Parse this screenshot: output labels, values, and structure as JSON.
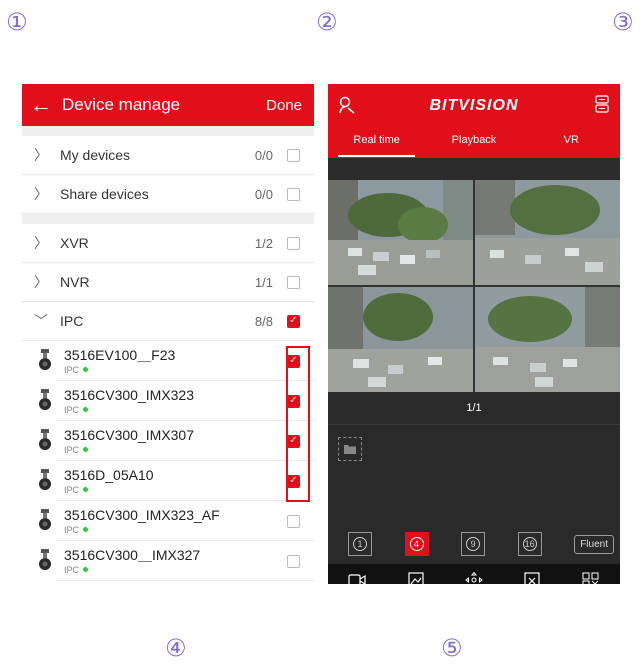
{
  "steps": [
    "①",
    "②",
    "③",
    "④",
    "⑤"
  ],
  "left": {
    "header": {
      "back_icon": "←",
      "title": "Device manage",
      "done": "Done"
    },
    "groups_top": [
      {
        "label": "My devices",
        "count": "0/0",
        "checked": false
      },
      {
        "label": "Share devices",
        "count": "0/0",
        "checked": false
      }
    ],
    "groups_mid": [
      {
        "label": "XVR",
        "count": "1/2",
        "checked": false
      },
      {
        "label": "NVR",
        "count": "1/1",
        "checked": false
      }
    ],
    "ipc_group": {
      "label": "IPC",
      "count": "8/8",
      "checked": true,
      "expanded": true
    },
    "devices": [
      {
        "name": "3516EV100＿F23",
        "type": "IPC",
        "online": true,
        "checked": true
      },
      {
        "name": "3516CV300_IMX323",
        "type": "IPC",
        "online": true,
        "checked": true
      },
      {
        "name": "3516CV300_IMX307",
        "type": "IPC",
        "online": true,
        "checked": true
      },
      {
        "name": "3516D_05A10",
        "type": "IPC",
        "online": true,
        "checked": true
      },
      {
        "name": "3516CV300_IMX323_AF",
        "type": "IPC",
        "online": true,
        "checked": false
      },
      {
        "name": "3516CV300＿IMX327",
        "type": "IPC",
        "online": true,
        "checked": false
      }
    ],
    "accent": "#e10f1a",
    "online_color": "#2ecc40"
  },
  "right": {
    "logo": "BITVISION",
    "tabs": [
      {
        "label": "Real time",
        "active": true
      },
      {
        "label": "Playback",
        "active": false
      },
      {
        "label": "VR",
        "active": false
      }
    ],
    "page": "1/1",
    "split_buttons": [
      "1",
      "4",
      "9",
      "16"
    ],
    "active_split": "4",
    "stream": "Fluent",
    "toolbar": [
      {
        "icon": "video-record-icon",
        "label": "Video"
      },
      {
        "icon": "screenshot-icon",
        "label": "Screenshot"
      },
      {
        "icon": "ptz-icon",
        "label": "PTZ"
      },
      {
        "icon": "close-icon",
        "label": "Close"
      },
      {
        "icon": "all-closed-icon",
        "label": "All closed"
      }
    ]
  }
}
